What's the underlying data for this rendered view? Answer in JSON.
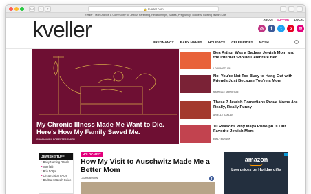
{
  "browser": {
    "url": "kveller.com",
    "tab_title": "Kveller • Mom Advice & Community for Jewish Parenting, Relationships, Babies, Pregnancy, Toddlers, Raising Jewish Kids"
  },
  "header": {
    "logo": "kveller",
    "utility_links": [
      "ABOUT",
      "SUPPORT",
      "LOCAL"
    ],
    "social_icons": [
      {
        "name": "instagram-icon",
        "glyph": "◎",
        "color": "#c13584"
      },
      {
        "name": "facebook-icon",
        "glyph": "f",
        "color": "#3b5998"
      },
      {
        "name": "twitter-icon",
        "glyph": "t",
        "color": "#1da1f2"
      },
      {
        "name": "pinterest-icon",
        "glyph": "p",
        "color": "#e60023"
      },
      {
        "name": "email-icon",
        "glyph": "✉",
        "color": "#e4007c"
      }
    ],
    "nav": [
      "PREGNANCY",
      "BABY NAMES",
      "HOLIDAYS",
      "CELEBRITIES",
      "NOSH"
    ]
  },
  "hero": {
    "title": "My Chronic Illness Made Me Want to Die. Here's How My Family Saved Me.",
    "author": "SHOSHANNA FORESTER SMITH"
  },
  "side_articles": [
    {
      "title": "Bea Arthur Was a Badass Jewish Mom and the Internet Should Celebrate Her",
      "author": "LORI GOTTLIEB"
    },
    {
      "title": "No, You're Not Too Busy to Hang Out with Friends Just Because You're a Mom",
      "author": "MICHELLE SHEROTON"
    },
    {
      "title": "These 7 Jewish Comedians Prove Moms Are Really, Really Funny",
      "author": "ARIELLE KAPLAN"
    },
    {
      "title": "10 Reasons Why Maya Rudolph Is Our Favorite Jewish Mom",
      "author": "EMILY BURACK"
    }
  ],
  "jewish_stuff": {
    "heading": "JEWISH STUFF!",
    "items": [
      "Baby Naming Rituals",
      "Interfaith",
      "Bris FAQs",
      "Circumcision FAQs",
      "Bar/Bat Mitzvah Guide"
    ]
  },
  "feature": {
    "tag": "HOLOCAUST",
    "title": "How My Visit to Auschwitz Made Me a Better Mom",
    "author": "LAURA BOGEN"
  },
  "ad": {
    "brand": "amazon",
    "text": "Low prices on Holiday gifts"
  }
}
